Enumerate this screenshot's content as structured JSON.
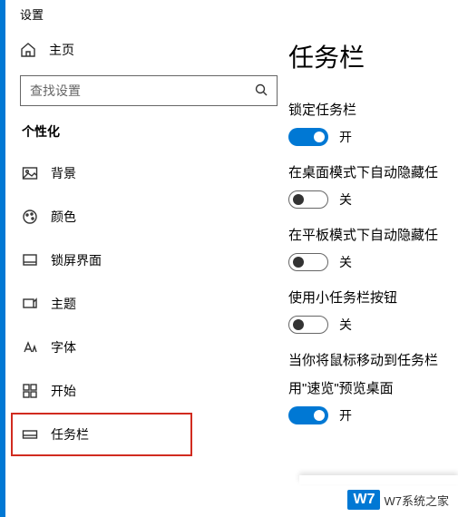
{
  "window": {
    "title": "设置"
  },
  "home": {
    "label": "主页"
  },
  "search": {
    "placeholder": "查找设置"
  },
  "section": {
    "title": "个性化"
  },
  "nav": {
    "items": [
      {
        "label": "背景"
      },
      {
        "label": "颜色"
      },
      {
        "label": "锁屏界面"
      },
      {
        "label": "主题"
      },
      {
        "label": "字体"
      },
      {
        "label": "开始"
      },
      {
        "label": "任务栏"
      }
    ]
  },
  "page": {
    "title": "任务栏"
  },
  "settings": [
    {
      "label": "锁定任务栏",
      "on": true,
      "state": "开"
    },
    {
      "label": "在桌面模式下自动隐藏任",
      "on": false,
      "state": "关"
    },
    {
      "label": "在平板模式下自动隐藏任",
      "on": false,
      "state": "关"
    },
    {
      "label": "使用小任务栏按钮",
      "on": false,
      "state": "关"
    },
    {
      "label": "当你将鼠标移动到任务栏",
      "label2": "用\"速览\"预览桌面",
      "on": true,
      "state": "开"
    }
  ],
  "watermark": {
    "box": "W7",
    "text": "W7系统之家"
  }
}
